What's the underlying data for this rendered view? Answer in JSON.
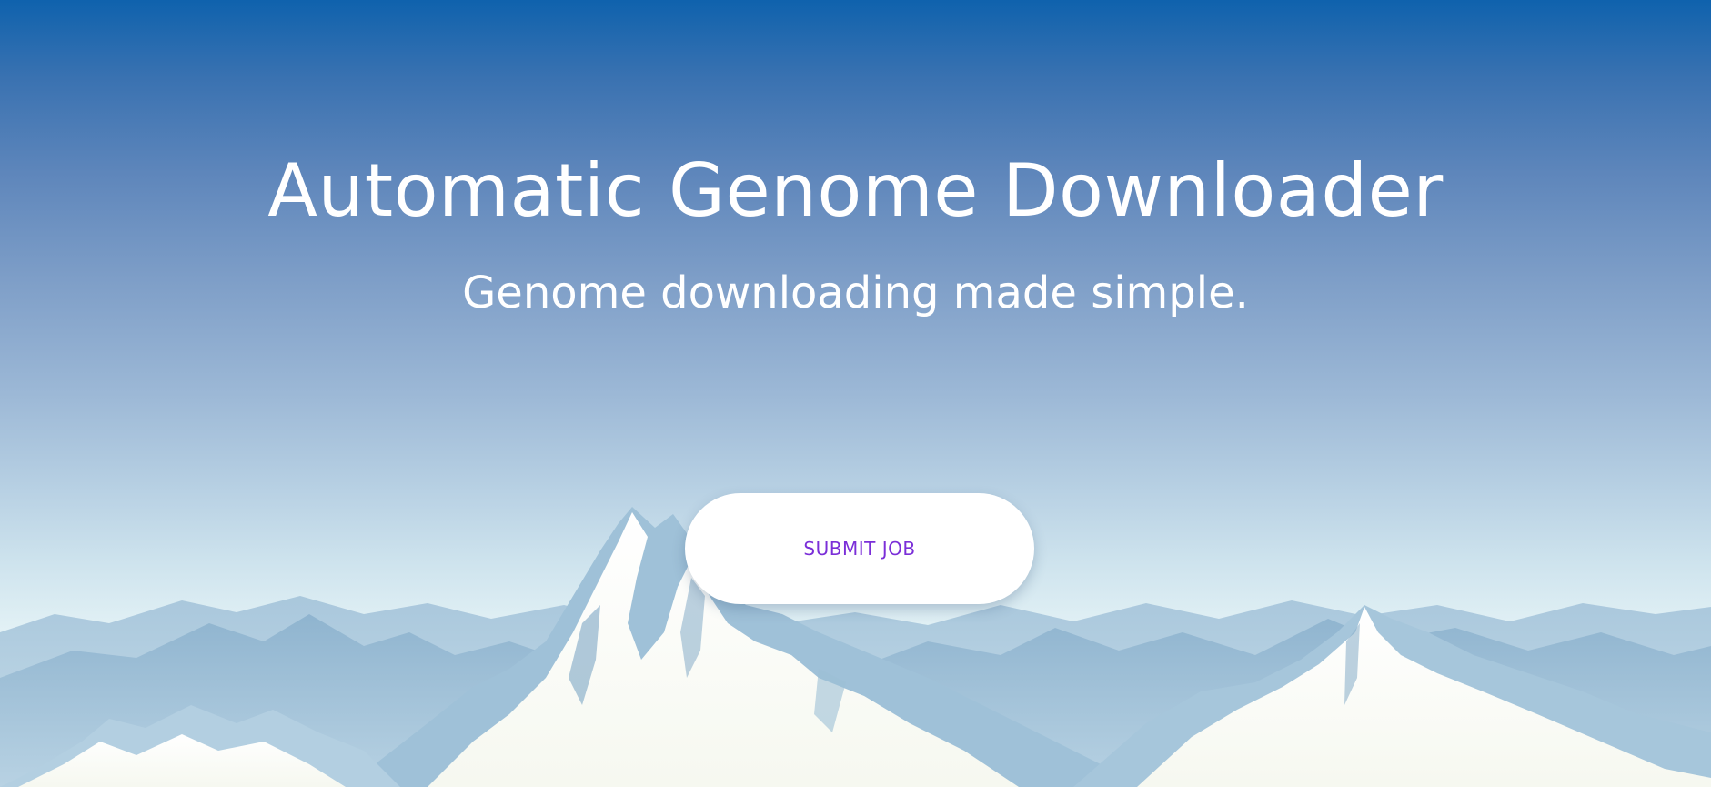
{
  "hero": {
    "title": "Automatic Genome Downloader",
    "subtitle": "Genome downloading made simple.",
    "submit_label": "SUBMIT JOB"
  },
  "colors": {
    "sky_top": "#0f62ad",
    "sky_bottom": "#eef7f8",
    "button_text": "#7b2fd8",
    "button_bg": "#ffffff",
    "title_text": "#ffffff"
  },
  "icons": {
    "background": "mountain-range-illustration"
  }
}
